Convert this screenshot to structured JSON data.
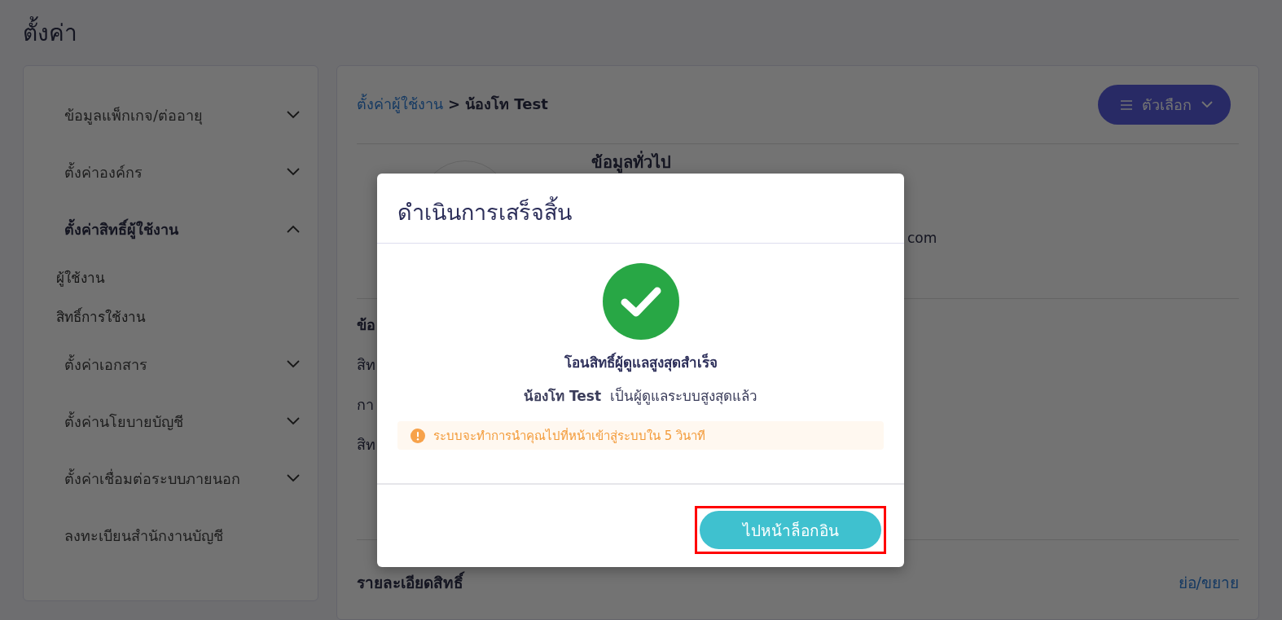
{
  "page_title": "ตั้งค่า",
  "sidebar": {
    "items": [
      {
        "kind": "group",
        "label": "ข้อมูลแพ็กเกจ/ต่ออายุ",
        "expanded": false
      },
      {
        "kind": "group",
        "label": "ตั้งค่าองค์กร",
        "expanded": false
      },
      {
        "kind": "group",
        "label": "ตั้งค่าสิทธิ์ผู้ใช้งาน",
        "expanded": true,
        "children": [
          {
            "label": "ผู้ใช้งาน"
          },
          {
            "label": "สิทธิ์การใช้งาน"
          }
        ]
      },
      {
        "kind": "group",
        "label": "ตั้งค่าเอกสาร",
        "expanded": false
      },
      {
        "kind": "group",
        "label": "ตั้งค่านโยบายบัญชี",
        "expanded": false
      },
      {
        "kind": "group",
        "label": "ตั้งค่าเชื่อมต่อระบบภายนอก",
        "expanded": false
      },
      {
        "kind": "link",
        "label": "ลงทะเบียนสำนักงานบัญชี"
      }
    ]
  },
  "main": {
    "breadcrumb": {
      "link": "ตั้งค่าผู้ใช้งาน",
      "separator": ">",
      "current": "น้องโท Test"
    },
    "options_button": "ตัวเลือก",
    "general_heading": "ข้อมูลทั่วไป",
    "email_fragment": "com",
    "section_fragments": [
      "ข้อ",
      "สิท",
      "กา",
      "สิท"
    ],
    "permissions_heading": "รายละเอียดสิทธิ์",
    "toggle_link": "ย่อ/ขยาย"
  },
  "dialog": {
    "title": "ดำเนินการเสร็จสิ้น",
    "message": "โอนสิทธิ์ผู้ดูแลสูงสุดสำเร็จ",
    "detail": "**น้องโท Test**  เป็นผู้ดูแลระบบสูงสุดแล้ว",
    "notice": "ระบบจะทำการนำคุณไปที่หน้าเข้าสู่ระบบใน 5 วินาที",
    "button": {
      "label": "ไปหน้าล็อกอิน",
      "highlighted": true
    }
  }
}
